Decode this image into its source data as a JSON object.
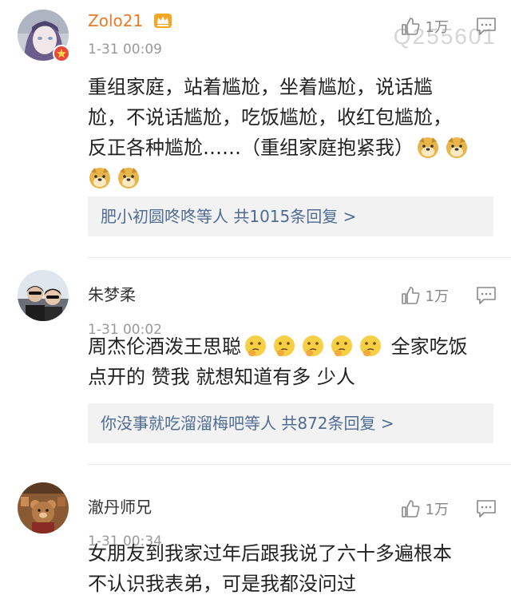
{
  "watermark": "Q255601",
  "comments": [
    {
      "username": "Zolo21",
      "time": "1-31 00:09",
      "likes": "1万",
      "lines": [
        "重组家庭，站着尴尬，坐着尴尬，说话尴",
        "尬，不说话尴尬，吃饭尴尬，收红包尴尬，",
        "反正各种尴尬……（重组家庭抱紧我）"
      ],
      "replies": "肥小初圆咚咚等人 共1015条回复 >"
    },
    {
      "username": "朱梦柔",
      "time": "1-31 00:02",
      "likes": "1万",
      "line1": "周杰伦酒泼王思聪",
      "line1b": " 全家吃饭",
      "line2": "点开的 赞我 就想知道有多 少人",
      "replies": "你没事就吃溜溜梅吧等人 共872条回复 >"
    },
    {
      "username": "澈丹师兄",
      "time": "1-31 00:34",
      "likes": "1万",
      "lines": [
        "女朋友到我家过年后跟我说了六十多遍根本",
        "不认识我表弟，可是我都没问过"
      ]
    }
  ],
  "colors": {
    "vip_name": "#e87b25",
    "link": "#4f6c95",
    "reply_bg": "#f2f2f2"
  }
}
